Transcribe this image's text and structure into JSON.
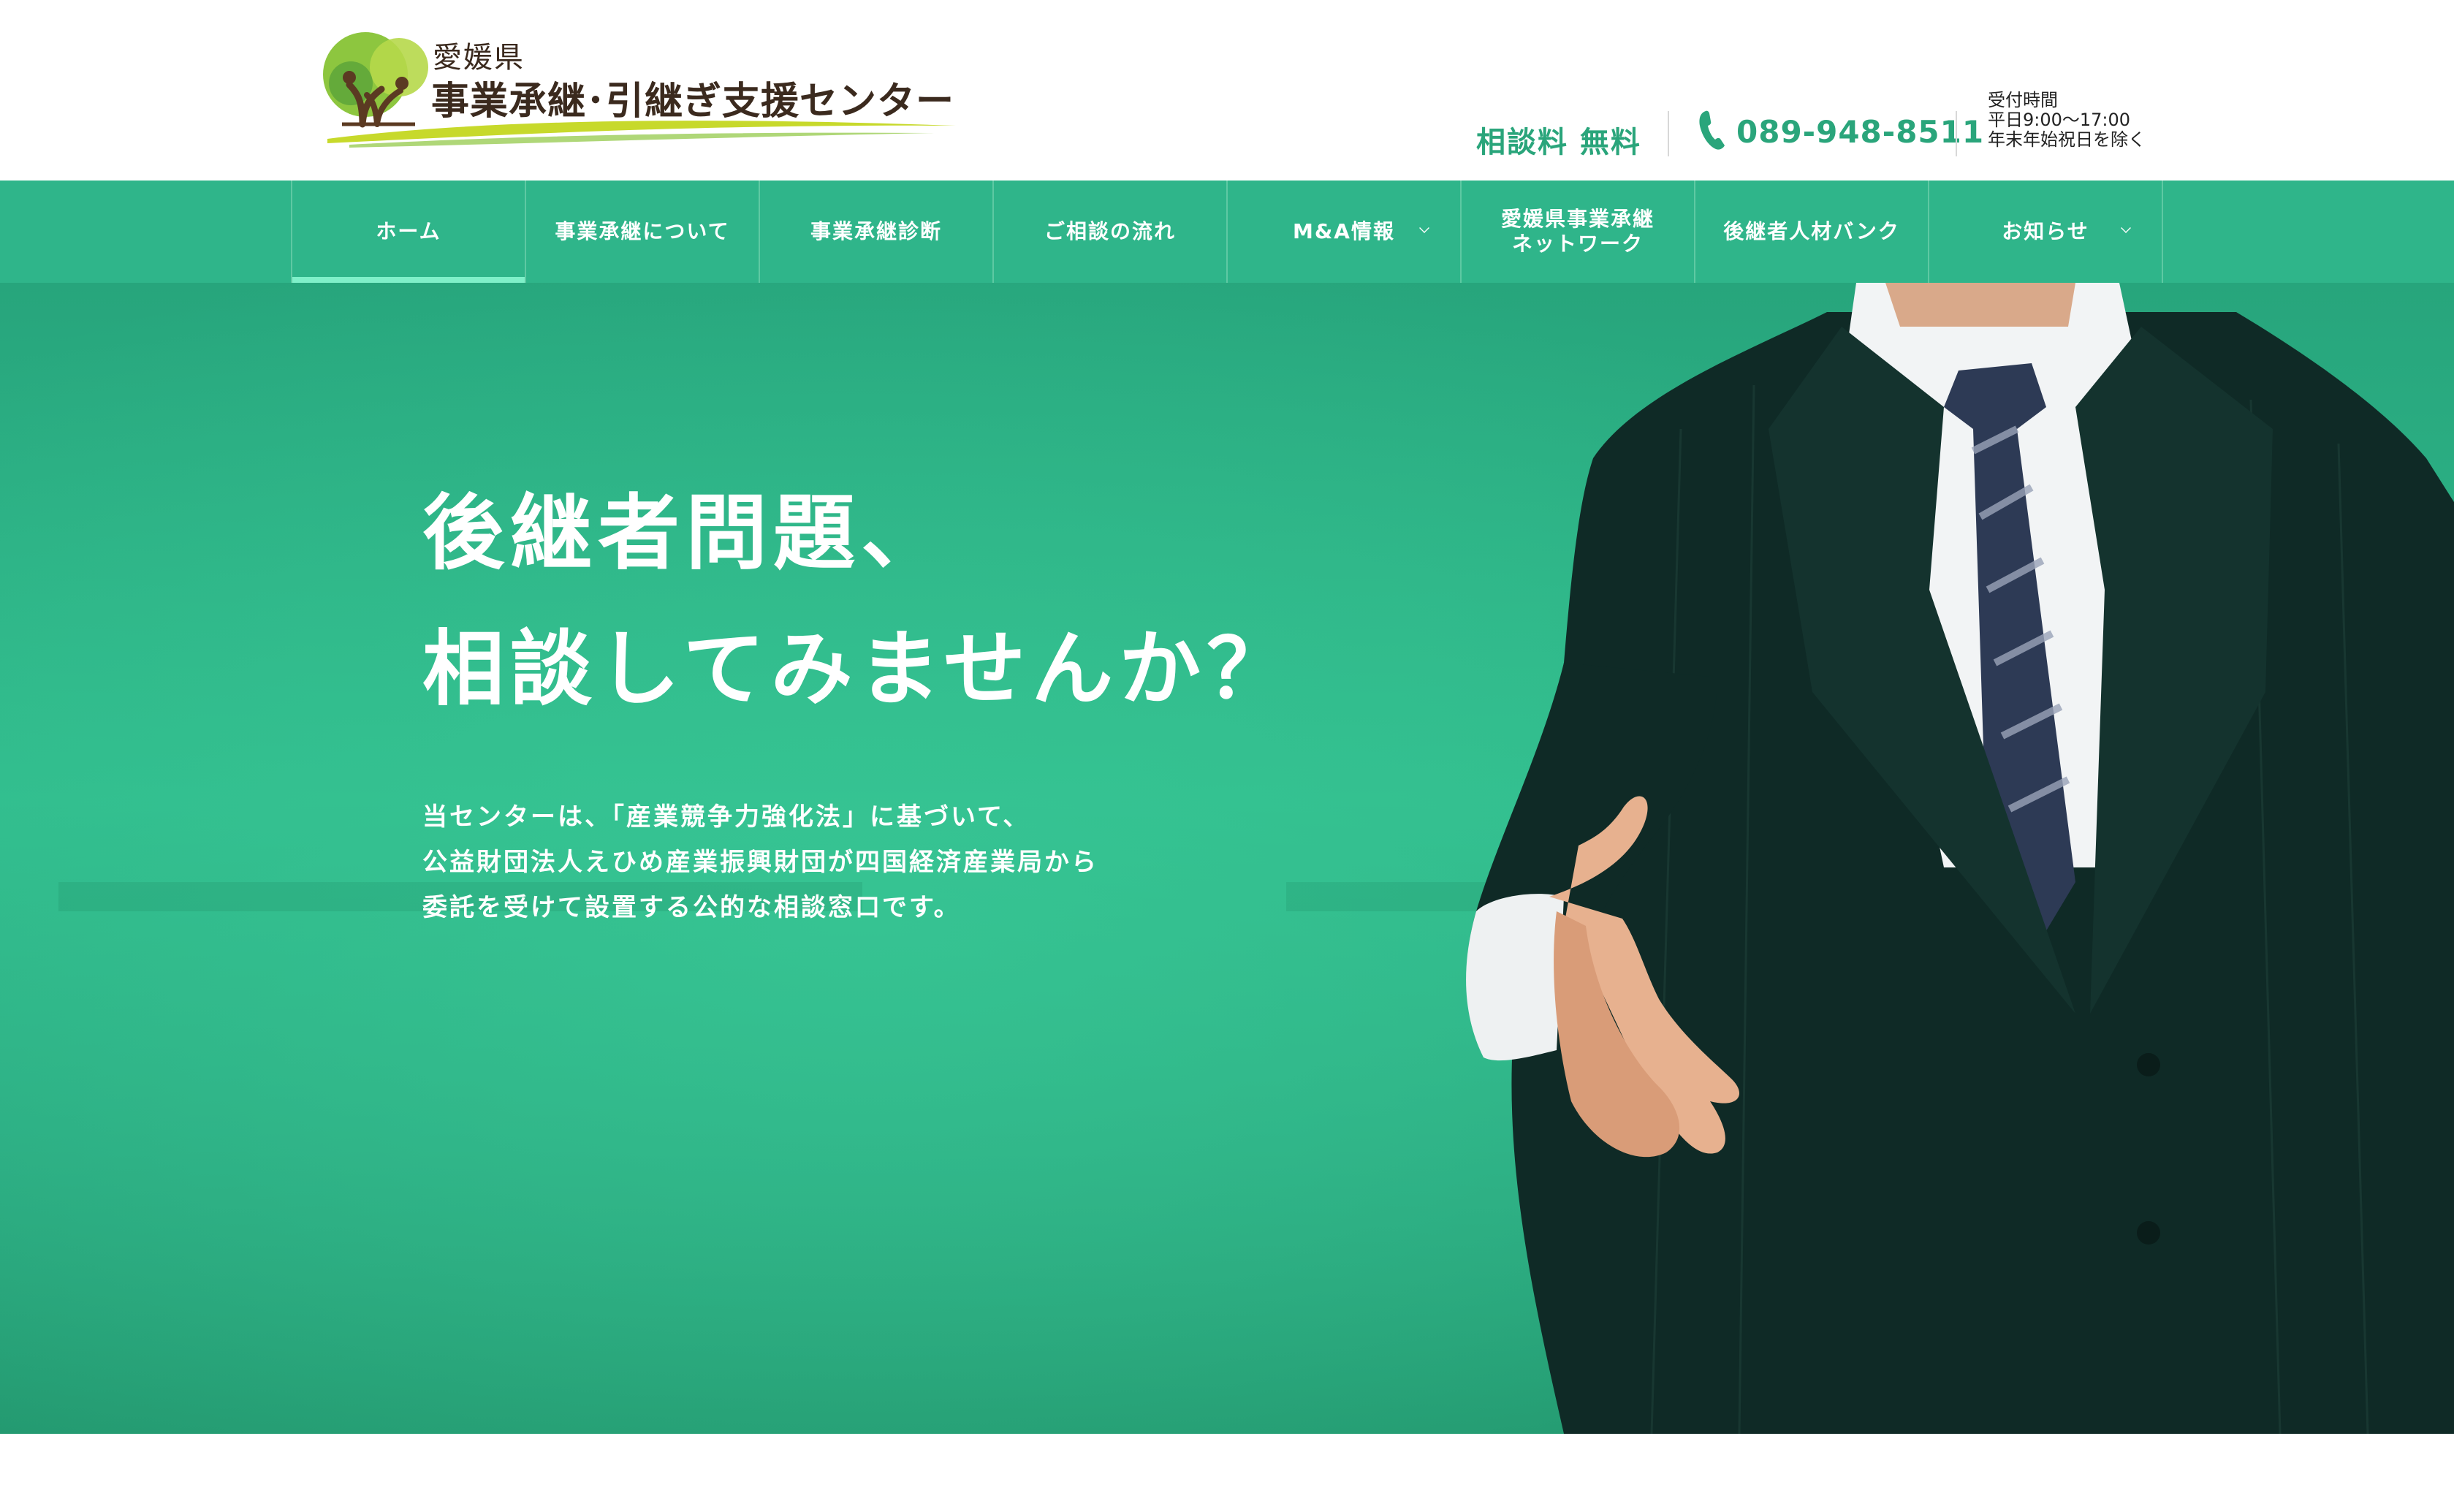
{
  "header": {
    "logo": {
      "prefecture": "愛媛県",
      "name": "事業承継･引継ぎ支援センター"
    },
    "contact": {
      "free_consult": "相談料 無料",
      "phone": "089-948-8511",
      "hours": [
        "受付時間",
        "平日9:00〜17:00",
        "年末年始祝日を除く"
      ]
    }
  },
  "nav": {
    "items": [
      {
        "label": "ホーム",
        "active": true
      },
      {
        "label": "事業承継について"
      },
      {
        "label": "事業承継診断"
      },
      {
        "label": "ご相談の流れ"
      },
      {
        "label": "M&A情報",
        "dropdown": true
      },
      {
        "label_lines": [
          "愛媛県事業承継",
          "ネットワーク"
        ]
      },
      {
        "label": "後継者人材バンク"
      },
      {
        "label": "お知らせ",
        "dropdown": true
      }
    ]
  },
  "hero": {
    "title_lines": [
      "後継者問題、",
      "相談してみませんか？"
    ],
    "desc_lines": [
      "当センターは、「産業競争力強化法」に基づいて、",
      "公益財団法人えひめ産業振興財団が四国経済産業局から",
      "委託を受けて設置する公的な相談窓口です。"
    ]
  },
  "colors": {
    "brand_green": "#2fb58a",
    "accent_text_green": "#2aa57b",
    "active_underline": "#7ff0c9",
    "logo_brown": "#3b2a1e"
  },
  "icons": [
    "logo-tree-icon",
    "phone-icon",
    "chevron-down-icon"
  ]
}
